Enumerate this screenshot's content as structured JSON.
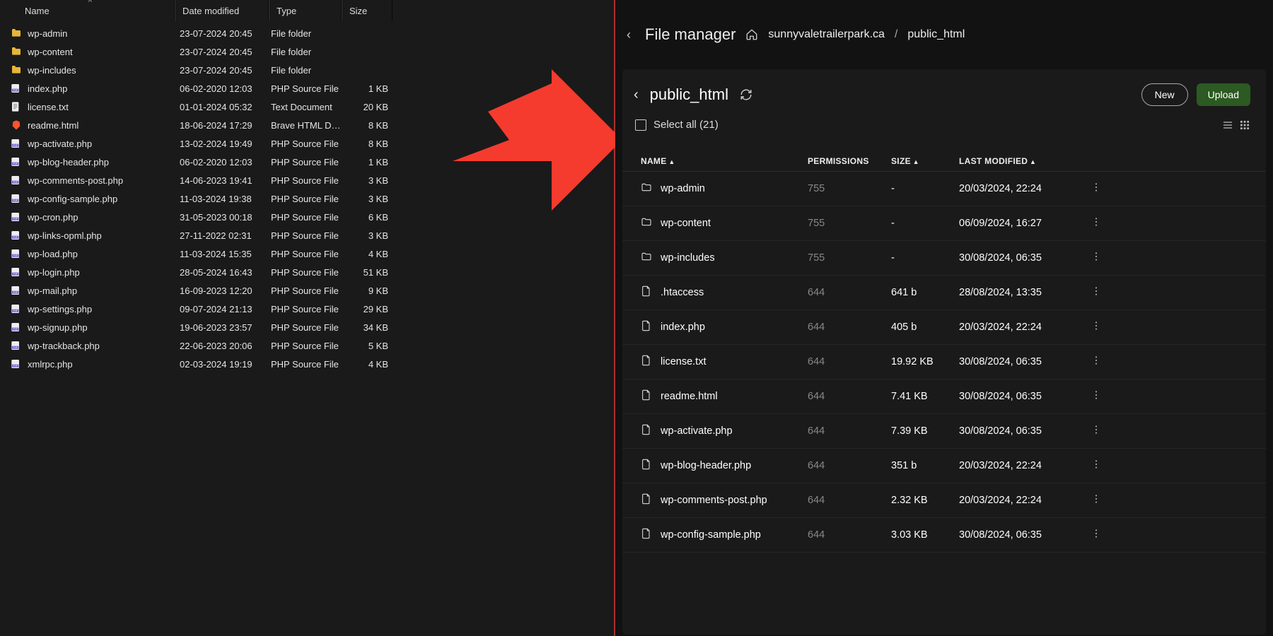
{
  "left": {
    "columns": {
      "name": "Name",
      "date": "Date modified",
      "type": "Type",
      "size": "Size"
    },
    "rows": [
      {
        "icon": "folder",
        "name": "wp-admin",
        "date": "23-07-2024 20:45",
        "type": "File folder",
        "size": ""
      },
      {
        "icon": "folder",
        "name": "wp-content",
        "date": "23-07-2024 20:45",
        "type": "File folder",
        "size": ""
      },
      {
        "icon": "folder",
        "name": "wp-includes",
        "date": "23-07-2024 20:45",
        "type": "File folder",
        "size": ""
      },
      {
        "icon": "php",
        "name": "index.php",
        "date": "06-02-2020 12:03",
        "type": "PHP Source File",
        "size": "1 KB"
      },
      {
        "icon": "txt",
        "name": "license.txt",
        "date": "01-01-2024 05:32",
        "type": "Text Document",
        "size": "20 KB"
      },
      {
        "icon": "brave",
        "name": "readme.html",
        "date": "18-06-2024 17:29",
        "type": "Brave HTML Docu…",
        "size": "8 KB"
      },
      {
        "icon": "php",
        "name": "wp-activate.php",
        "date": "13-02-2024 19:49",
        "type": "PHP Source File",
        "size": "8 KB"
      },
      {
        "icon": "php",
        "name": "wp-blog-header.php",
        "date": "06-02-2020 12:03",
        "type": "PHP Source File",
        "size": "1 KB"
      },
      {
        "icon": "php",
        "name": "wp-comments-post.php",
        "date": "14-06-2023 19:41",
        "type": "PHP Source File",
        "size": "3 KB"
      },
      {
        "icon": "php",
        "name": "wp-config-sample.php",
        "date": "11-03-2024 19:38",
        "type": "PHP Source File",
        "size": "3 KB"
      },
      {
        "icon": "php",
        "name": "wp-cron.php",
        "date": "31-05-2023 00:18",
        "type": "PHP Source File",
        "size": "6 KB"
      },
      {
        "icon": "php",
        "name": "wp-links-opml.php",
        "date": "27-11-2022 02:31",
        "type": "PHP Source File",
        "size": "3 KB"
      },
      {
        "icon": "php",
        "name": "wp-load.php",
        "date": "11-03-2024 15:35",
        "type": "PHP Source File",
        "size": "4 KB"
      },
      {
        "icon": "php",
        "name": "wp-login.php",
        "date": "28-05-2024 16:43",
        "type": "PHP Source File",
        "size": "51 KB"
      },
      {
        "icon": "php",
        "name": "wp-mail.php",
        "date": "16-09-2023 12:20",
        "type": "PHP Source File",
        "size": "9 KB"
      },
      {
        "icon": "php",
        "name": "wp-settings.php",
        "date": "09-07-2024 21:13",
        "type": "PHP Source File",
        "size": "29 KB"
      },
      {
        "icon": "php",
        "name": "wp-signup.php",
        "date": "19-06-2023 23:57",
        "type": "PHP Source File",
        "size": "34 KB"
      },
      {
        "icon": "php",
        "name": "wp-trackback.php",
        "date": "22-06-2023 20:06",
        "type": "PHP Source File",
        "size": "5 KB"
      },
      {
        "icon": "php",
        "name": "xmlrpc.php",
        "date": "02-03-2024 19:19",
        "type": "PHP Source File",
        "size": "4 KB"
      }
    ]
  },
  "right": {
    "crumb": {
      "title": "File manager",
      "root": "sunnyvaletrailerpark.ca",
      "current": "public_html"
    },
    "panel": {
      "folder": "public_html",
      "new_label": "New",
      "upload_label": "Upload",
      "select_all_label": "Select all (21)",
      "columns": {
        "name": "NAME",
        "perm": "PERMISSIONS",
        "size": "SIZE",
        "mod": "LAST MODIFIED"
      },
      "rows": [
        {
          "icon": "folder",
          "name": "wp-admin",
          "perm": "755",
          "size": "-",
          "mod": "20/03/2024, 22:24"
        },
        {
          "icon": "folder",
          "name": "wp-content",
          "perm": "755",
          "size": "-",
          "mod": "06/09/2024, 16:27"
        },
        {
          "icon": "folder",
          "name": "wp-includes",
          "perm": "755",
          "size": "-",
          "mod": "30/08/2024, 06:35"
        },
        {
          "icon": "file",
          "name": ".htaccess",
          "perm": "644",
          "size": "641 b",
          "mod": "28/08/2024, 13:35"
        },
        {
          "icon": "file",
          "name": "index.php",
          "perm": "644",
          "size": "405 b",
          "mod": "20/03/2024, 22:24"
        },
        {
          "icon": "file",
          "name": "license.txt",
          "perm": "644",
          "size": "19.92 KB",
          "mod": "30/08/2024, 06:35"
        },
        {
          "icon": "file",
          "name": "readme.html",
          "perm": "644",
          "size": "7.41 KB",
          "mod": "30/08/2024, 06:35"
        },
        {
          "icon": "file",
          "name": "wp-activate.php",
          "perm": "644",
          "size": "7.39 KB",
          "mod": "30/08/2024, 06:35"
        },
        {
          "icon": "file",
          "name": "wp-blog-header.php",
          "perm": "644",
          "size": "351 b",
          "mod": "20/03/2024, 22:24"
        },
        {
          "icon": "file",
          "name": "wp-comments-post.php",
          "perm": "644",
          "size": "2.32 KB",
          "mod": "20/03/2024, 22:24"
        },
        {
          "icon": "file",
          "name": "wp-config-sample.php",
          "perm": "644",
          "size": "3.03 KB",
          "mod": "30/08/2024, 06:35"
        }
      ]
    }
  }
}
